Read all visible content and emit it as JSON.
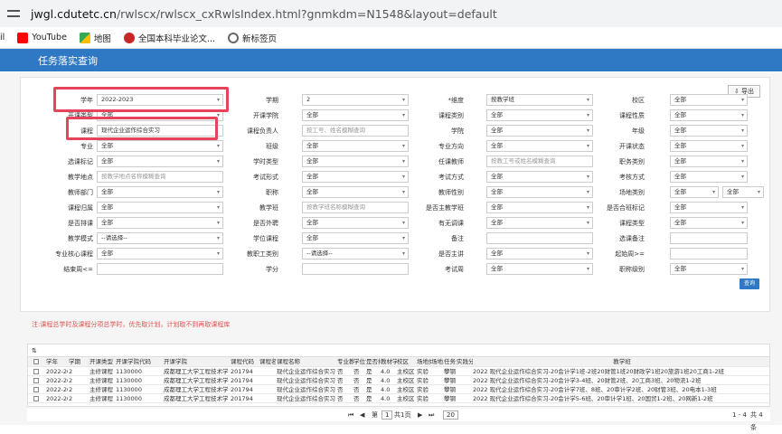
{
  "browser": {
    "url_host": "jwgl.cdutetc.cn",
    "url_path": "/rwlscx/rwlscx_cxRwlsIndex.html?gnmkdm=N1548&layout=default"
  },
  "bookmarks": [
    {
      "label": "il"
    },
    {
      "label": "YouTube"
    },
    {
      "label": "地图"
    },
    {
      "label": "全国本科毕业论文..."
    },
    {
      "label": "新标签页"
    }
  ],
  "page_title": "任务落实查询",
  "export_label": "导出",
  "form": [
    {
      "label": "学年",
      "value": "2022-2023",
      "select": true
    },
    {
      "label": "学期",
      "value": "2",
      "select": true
    },
    {
      "label": "*维度",
      "value": "按教学班",
      "select": true
    },
    {
      "label": "校区",
      "value": "全部",
      "select": true
    },
    {
      "label": "开课类型",
      "value": "全部",
      "select": true
    },
    {
      "label": "开课学院",
      "value": "全部",
      "select": true
    },
    {
      "label": "课程类别",
      "value": "全部",
      "select": true
    },
    {
      "label": "课程性质",
      "value": "全部",
      "select": true
    },
    {
      "label": "课程",
      "value": "现代企业运作综合实习",
      "select": false
    },
    {
      "label": "课程负责人",
      "placeholder": "按工号、姓名模糊查询"
    },
    {
      "label": "学院",
      "value": "全部",
      "select": true
    },
    {
      "label": "年级",
      "value": "全部",
      "select": true
    },
    {
      "label": "专业",
      "value": "全部",
      "select": true
    },
    {
      "label": "班级",
      "value": "全部",
      "select": true
    },
    {
      "label": "专业方向",
      "value": "全部",
      "select": true
    },
    {
      "label": "开课状态",
      "value": "全部",
      "select": true
    },
    {
      "label": "选课标记",
      "value": "全部",
      "select": true
    },
    {
      "label": "学时类型",
      "value": "全部",
      "select": true
    },
    {
      "label": "任课教师",
      "placeholder": "按教工号或姓名模糊查询"
    },
    {
      "label": "职务类别",
      "value": "全部",
      "select": true
    },
    {
      "label": "教学地点",
      "placeholder": "按教学地点名称模糊查询"
    },
    {
      "label": "考试形式",
      "value": "全部",
      "select": true
    },
    {
      "label": "考试方式",
      "value": "全部",
      "select": true
    },
    {
      "label": "考核方式",
      "value": "全部",
      "select": true
    },
    {
      "label": "教师部门",
      "value": "全部",
      "select": true
    },
    {
      "label": "职称",
      "value": "全部",
      "select": true
    },
    {
      "label": "教师性别",
      "value": "全部",
      "select": true
    },
    {
      "label": "场地类别",
      "value": "全部",
      "select": true,
      "extra": "全部"
    },
    {
      "label": "课程归属",
      "value": "全部",
      "select": true
    },
    {
      "label": "教学班",
      "placeholder": "按教学班名称模糊查询"
    },
    {
      "label": "是否主教学班",
      "value": "全部",
      "select": true
    },
    {
      "label": "是否合班标记",
      "value": "全部",
      "select": true
    },
    {
      "label": "是否排课",
      "value": "全部",
      "select": true
    },
    {
      "label": "是否外聘",
      "value": "全部",
      "select": true
    },
    {
      "label": "有无调课",
      "value": "全部",
      "select": true
    },
    {
      "label": "课程类型",
      "value": "全部",
      "select": true
    },
    {
      "label": "教学模式",
      "value": "--请选择--",
      "select": true
    },
    {
      "label": "学位课程",
      "value": "全部",
      "select": true
    },
    {
      "label": "备注",
      "value": "",
      "select": false
    },
    {
      "label": "选课备注",
      "value": "",
      "select": false
    },
    {
      "label": "专业核心课程",
      "value": "全部",
      "select": true
    },
    {
      "label": "教职工类别",
      "value": "--请选择--",
      "select": true
    },
    {
      "label": "是否主讲",
      "value": "全部",
      "select": true
    },
    {
      "label": "起始周>=",
      "value": "",
      "select": false
    },
    {
      "label": "结束周<=",
      "value": "",
      "select": false
    },
    {
      "label": "学分",
      "value": "",
      "select": false
    },
    {
      "label": "考试周",
      "value": "全部",
      "select": true
    },
    {
      "label": "职称级别",
      "value": "全部",
      "select": true
    }
  ],
  "query_label": "查询",
  "note": "注:课程总学时及课程分项总学时，优先取计划，计划取不到再取课程库",
  "table": {
    "toolbar_icon": "⇅",
    "headers": [
      "学年",
      "学期",
      "开课类型",
      "开课学院代码",
      "开课学院",
      "课程代码",
      "课程名",
      "课程名称",
      "专业教学",
      "学位课程",
      "是否排课",
      "教材学分",
      "校区",
      "场地类别",
      "场地二",
      "任务分",
      "实践分",
      "教学班"
    ],
    "rows": [
      [
        "2022-2023",
        "2",
        "主修课程",
        "1130000",
        "成都理工大学工程技术学院",
        "201794",
        "",
        "现代企业运作综合实习",
        "否",
        "否",
        "是",
        "4.0",
        "主校区",
        "实验",
        "",
        "攀钢",
        "",
        "2022 现代企业运作综合实习-20会计学1班-2班20财管1班20财政学1班20旅游1班20工商1-2班"
      ],
      [
        "2022-2023",
        "2",
        "主修课程",
        "1130000",
        "成都理工大学工程技术学院",
        "201794",
        "",
        "现代企业运作综合实习",
        "否",
        "否",
        "是",
        "4.0",
        "主校区",
        "实验",
        "",
        "攀钢",
        "",
        "2022 现代企业运作综合实习-20会计学3-4班、20财管2班、20工商3班、20物流1-2班"
      ],
      [
        "2022-2023",
        "2",
        "主修课程",
        "1130000",
        "成都理工大学工程技术学院",
        "201794",
        "",
        "现代企业运作综合实习",
        "否",
        "否",
        "是",
        "4.0",
        "主校区",
        "实验",
        "",
        "攀钢",
        "",
        "2022 现代企业运作综合实习-20会计学7班、8班、20审计学2班、20财管3班、20电本1-3班"
      ],
      [
        "2022-2023",
        "2",
        "主修课程",
        "1130000",
        "成都理工大学工程技术学院",
        "201794",
        "",
        "现代企业运作综合实习",
        "否",
        "否",
        "是",
        "4.0",
        "主校区",
        "实验",
        "",
        "攀钢",
        "",
        "2022 现代企业运作综合实习-20会计学5-6班、20审计学1班、20国贸1-2班、20网新1-2班"
      ]
    ]
  },
  "pager": {
    "page_label": "第",
    "page": "1",
    "total_label": "共1页",
    "page_size": "20",
    "range": "1 - 4",
    "total": "共 4 条"
  },
  "colors": {
    "accent": "#2f78c4",
    "highlight": "#e6445a"
  }
}
